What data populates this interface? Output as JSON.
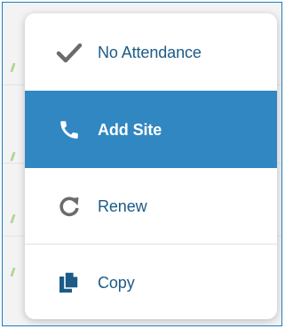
{
  "menu": {
    "items": [
      {
        "label": "No Attendance",
        "icon": "check-icon"
      },
      {
        "label": "Add Site",
        "icon": "phone-icon",
        "state": "highlighted"
      },
      {
        "label": "Renew",
        "icon": "redo-icon"
      },
      {
        "label": "Copy",
        "icon": "copy-icon"
      }
    ]
  },
  "colors": {
    "highlight": "#3187c1",
    "link_text": "#1c5b87",
    "icon_gray": "#6b6b6b",
    "icon_blue": "#1c5b87",
    "frame_border": "#1a7fc0"
  }
}
